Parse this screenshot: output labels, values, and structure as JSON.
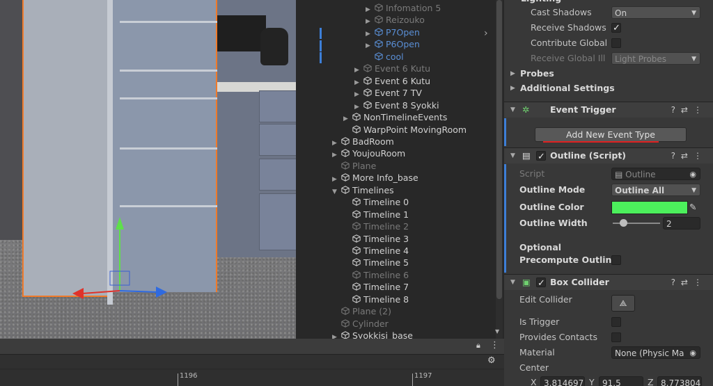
{
  "hierarchy": {
    "rows": [
      {
        "label": "Infomation 5",
        "indent": 100,
        "arrow": "▶",
        "style": "dim"
      },
      {
        "label": "Reizouko",
        "indent": 100,
        "arrow": "▶",
        "style": "dim"
      },
      {
        "label": "P7Open",
        "indent": 100,
        "arrow": "▶",
        "style": "blue"
      },
      {
        "label": "P6Open",
        "indent": 100,
        "arrow": "▶",
        "style": "blue"
      },
      {
        "label": "cool",
        "indent": 100,
        "arrow": "",
        "style": "blue"
      },
      {
        "label": "Event 6 Kutu",
        "indent": 84,
        "arrow": "▶",
        "style": "dim"
      },
      {
        "label": "Event 6 Kutu",
        "indent": 84,
        "arrow": "▶",
        "style": ""
      },
      {
        "label": "Event 7 TV",
        "indent": 84,
        "arrow": "▶",
        "style": ""
      },
      {
        "label": "Event 8 Syokki",
        "indent": 84,
        "arrow": "▶",
        "style": ""
      },
      {
        "label": "NonTimelineEvents",
        "indent": 68,
        "arrow": "▶",
        "style": ""
      },
      {
        "label": "WarpPoint MovingRoom",
        "indent": 68,
        "arrow": "",
        "style": ""
      },
      {
        "label": "BadRoom",
        "indent": 52,
        "arrow": "▶",
        "style": ""
      },
      {
        "label": "YoujouRoom",
        "indent": 52,
        "arrow": "▶",
        "style": ""
      },
      {
        "label": "Plane",
        "indent": 52,
        "arrow": "",
        "style": "dim"
      },
      {
        "label": "More Info_base",
        "indent": 52,
        "arrow": "▶",
        "style": ""
      },
      {
        "label": "Timelines",
        "indent": 52,
        "arrow": "▼",
        "style": ""
      },
      {
        "label": "Timeline 0",
        "indent": 68,
        "arrow": "",
        "style": ""
      },
      {
        "label": "Timeline 1",
        "indent": 68,
        "arrow": "",
        "style": ""
      },
      {
        "label": "Timeline 2",
        "indent": 68,
        "arrow": "",
        "style": "dim"
      },
      {
        "label": "Timeline 3",
        "indent": 68,
        "arrow": "",
        "style": ""
      },
      {
        "label": "Timeline 4",
        "indent": 68,
        "arrow": "",
        "style": ""
      },
      {
        "label": "Timeline 5",
        "indent": 68,
        "arrow": "",
        "style": ""
      },
      {
        "label": "Timeline 6",
        "indent": 68,
        "arrow": "",
        "style": "dim"
      },
      {
        "label": "Timeline 7",
        "indent": 68,
        "arrow": "",
        "style": ""
      },
      {
        "label": "Timeline 8",
        "indent": 68,
        "arrow": "",
        "style": ""
      },
      {
        "label": "Plane (2)",
        "indent": 52,
        "arrow": "",
        "style": "dim"
      },
      {
        "label": "Cylinder",
        "indent": 52,
        "arrow": "",
        "style": "dim"
      },
      {
        "label": "Syokkisi_base",
        "indent": 52,
        "arrow": "▶",
        "style": ""
      }
    ]
  },
  "inspector": {
    "lighting_title": "Lighting",
    "cast_shadows_label": "Cast Shadows",
    "cast_shadows_value": "On",
    "receive_shadows_label": "Receive Shadows",
    "contribute_global_label": "Contribute Global",
    "receive_gi_label": "Receive Global Ill",
    "receive_gi_value": "Light Probes",
    "probes_label": "Probes",
    "additional_settings_label": "Additional Settings",
    "event_trigger_title": "Event Trigger",
    "add_event_button": "Add New Event Type",
    "outline_title": "Outline (Script)",
    "script_label": "Script",
    "script_value": "Outline",
    "outline_mode_label": "Outline Mode",
    "outline_mode_value": "Outline All",
    "outline_color_label": "Outline Color",
    "outline_color": "#4cf05c",
    "outline_width_label": "Outline Width",
    "outline_width_value": "2",
    "optional_label": "Optional",
    "precompute_label": "Precompute Outline",
    "box_collider_title": "Box Collider",
    "edit_collider_label": "Edit Collider",
    "is_trigger_label": "Is Trigger",
    "provides_contacts_label": "Provides Contacts",
    "material_label": "Material",
    "material_value": "None (Physic Ma",
    "center_label": "Center",
    "center_x_label": "X",
    "center_x": "3.814697",
    "center_y_label": "Y",
    "center_y": "91.5",
    "center_z_label": "Z",
    "center_z": "8.773804"
  },
  "timeline": {
    "tick1": "1196",
    "tick2": "1197"
  }
}
